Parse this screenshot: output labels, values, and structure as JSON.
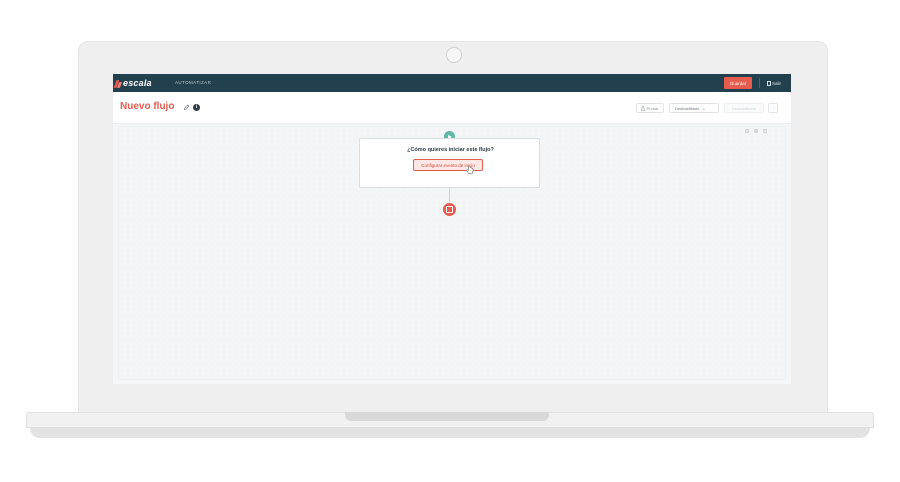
{
  "app": {
    "brand": "escala",
    "section": "AUTOMATIZAR",
    "save_label": "Guardar",
    "exit_label": "Salir"
  },
  "header": {
    "title": "Nuevo flujo",
    "info_glyph": "i",
    "test_label": "Probar",
    "status_value": "Deshabilitado",
    "status_chevron": "⌄",
    "disabled_action": "Deshabilitado",
    "more_glyph": "⋮"
  },
  "flow": {
    "question": "¿Cómo quieres iniciar este flujo?",
    "config_label": "Configurar evento de inicio"
  },
  "icons": {
    "brand_mark": "escala-logo",
    "pencil": "pencil-icon",
    "info": "info-icon",
    "exit": "exit-icon",
    "test": "flask-icon",
    "zoom_out": "zoom-out-icon",
    "zoom_in": "zoom-in-icon",
    "fit": "fit-icon"
  },
  "colors": {
    "nav_bg": "#23404e",
    "accent": "#e65c4f",
    "start_node": "#5fb8a6"
  }
}
